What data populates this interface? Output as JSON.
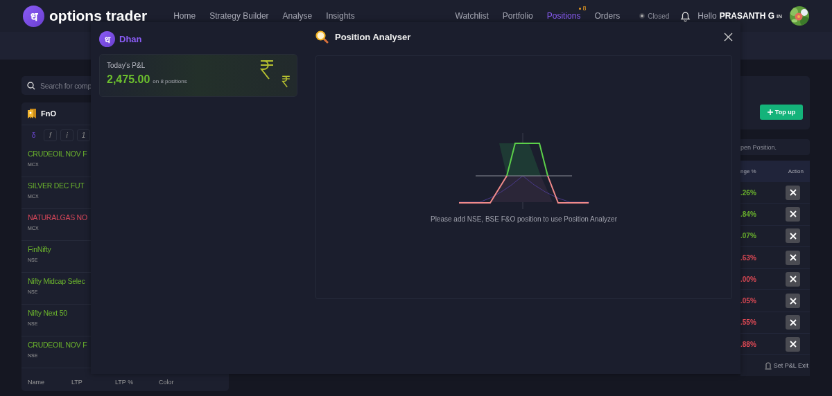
{
  "header": {
    "logo_letter": "ध",
    "brand": "options trader",
    "nav": [
      {
        "label": "Home",
        "selected": false
      },
      {
        "label": "Strategy Builder",
        "selected": false
      },
      {
        "label": "Analyse",
        "selected": false
      },
      {
        "label": "Insights",
        "selected": false
      }
    ],
    "right_nav": [
      {
        "label": "Watchlist",
        "selected": false
      },
      {
        "label": "Portfolio",
        "selected": false
      },
      {
        "label": "Positions",
        "selected": true,
        "badge": "8"
      },
      {
        "label": "Orders",
        "selected": false
      }
    ],
    "market_status": "Closed",
    "greeting": "Hello",
    "user": "PRASANTH G",
    "user_suffix": "IN"
  },
  "watchlist": {
    "search_placeholder": "Search for comp",
    "title": "FnO",
    "filters": [
      {
        "label": "δ",
        "selected": true
      },
      {
        "label": "f",
        "selected": false
      },
      {
        "label": "i",
        "selected": false
      },
      {
        "label": "1",
        "selected": false
      }
    ],
    "items": [
      {
        "name": "CRUDEOIL NOV F",
        "exchange": "MCX",
        "color": "#6cb52d"
      },
      {
        "name": "SILVER DEC FUT",
        "exchange": "MCX",
        "color": "#6cb52d"
      },
      {
        "name": "NATURALGAS NO",
        "exchange": "MCX",
        "color": "#d9475a"
      },
      {
        "name": "FinNifty",
        "exchange": "NSE",
        "color": "#6cb52d"
      },
      {
        "name": "Nifty Midcap Selec",
        "exchange": "NSE",
        "color": "#6cb52d"
      },
      {
        "name": "Nifty Next 50",
        "exchange": "NSE",
        "color": "#6cb52d"
      },
      {
        "name": "CRUDEOIL NOV F",
        "exchange": "NSE",
        "color": "#6cb52d"
      }
    ],
    "columns": [
      "Name",
      "LTP",
      "LTP %",
      "Color"
    ]
  },
  "positions": {
    "topup": "Top up",
    "search_placeholder": "pen Position.",
    "columns": [
      "nge %",
      "Action"
    ],
    "rows": [
      {
        "change": ".26%",
        "color": "#6cb52d"
      },
      {
        "change": ".84%",
        "color": "#6cb52d"
      },
      {
        "change": ".07%",
        "color": "#6cb52d"
      },
      {
        "change": ".63%",
        "color": "#e04a55"
      },
      {
        "change": ".00%",
        "color": "#e04a55"
      },
      {
        "change": ".05%",
        "color": "#e04a55"
      },
      {
        "change": ".55%",
        "color": "#e04a55"
      },
      {
        "change": ".88%",
        "color": "#e04a55"
      }
    ],
    "footer": "Set P&L Exit"
  },
  "modal": {
    "logo_letter": "ध",
    "brand": "Dhan",
    "pnl": {
      "label": "Today's P&L",
      "value": "2,475.00",
      "note": "on 8 positions"
    },
    "title": "Position Analyser",
    "empty_message": "Please add NSE, BSE F&O position to use Position Analyzer"
  }
}
